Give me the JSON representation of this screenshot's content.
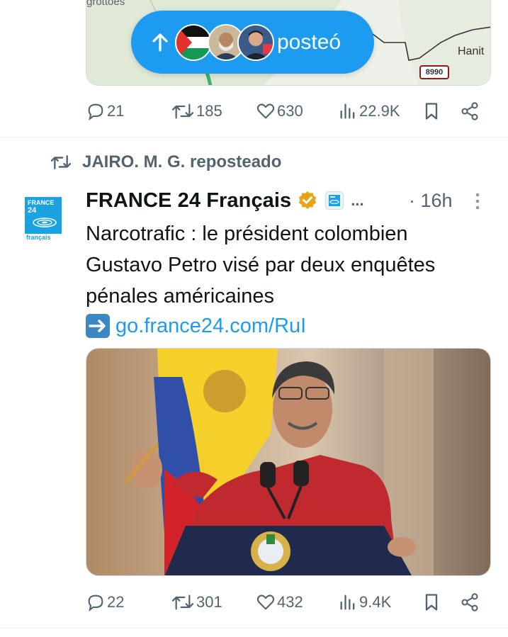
{
  "previous_tweet": {
    "map": {
      "place_label_top": "grottoes",
      "place_label_right": "Hanit",
      "road_number": "8990"
    },
    "posted_pill": {
      "label": "posteó",
      "avatars": [
        "palestine-flag-avatar",
        "person-avatar-1",
        "person-avatar-2"
      ]
    },
    "actions": {
      "replies": "21",
      "reposts": "185",
      "likes": "630",
      "views": "22.9K"
    }
  },
  "repost_header": {
    "text": "JAIRO. M. G. reposteado",
    "icon": "repost-icon"
  },
  "tweet": {
    "avatar": {
      "line1": "FRANCE",
      "line2": "24",
      "line3": "français"
    },
    "display_name": "FRANCE 24 Français",
    "verified_icon": "gold-verified-badge-icon",
    "affiliation_icon": "france24-affiliate-badge-icon",
    "truncation": "...",
    "time": "· 16h",
    "text_lines": [
      "Narcotrafic : le président colombien",
      "Gustavo Petro visé par deux enquêtes",
      "pénales américaines"
    ],
    "link_icon": "right-arrow-emoji-icon",
    "link": "go.france24.com/RuI",
    "actions": {
      "replies": "22",
      "reposts": "301",
      "likes": "432",
      "views": "9.4K"
    }
  },
  "colors": {
    "accent": "#1d9bf0",
    "muted": "#536471",
    "text": "#0f1419",
    "verified_gold": "#e8a317"
  }
}
